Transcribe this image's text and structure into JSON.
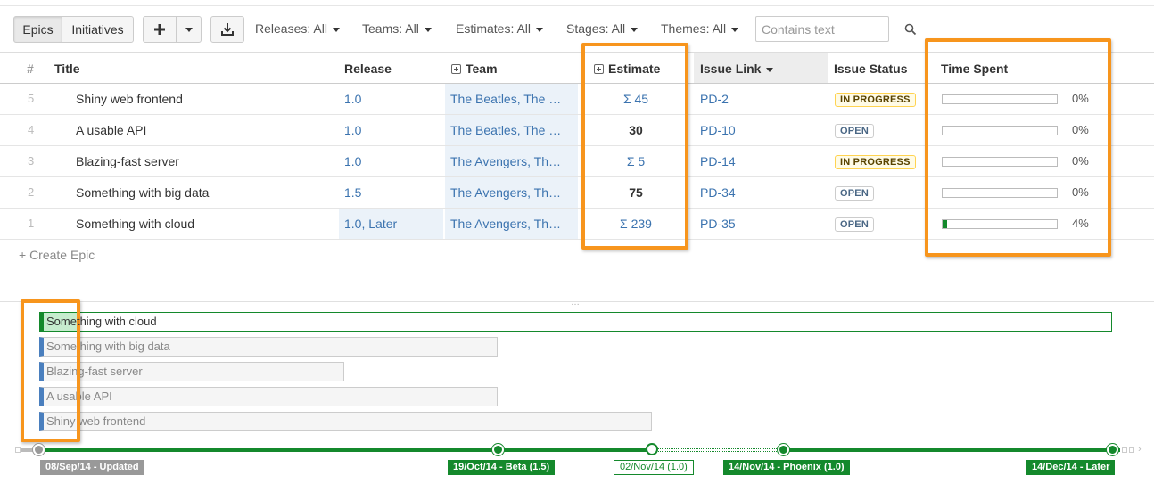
{
  "toolbar": {
    "tabs": [
      {
        "label": "Epics",
        "active": true
      },
      {
        "label": "Initiatives",
        "active": false
      }
    ],
    "add_icon": "plus-icon",
    "dropdown_icon": "chevron-down-icon",
    "download_icon": "download-icon",
    "filters": [
      {
        "label": "Releases: All"
      },
      {
        "label": "Teams: All"
      },
      {
        "label": "Estimates: All"
      },
      {
        "label": "Stages: All"
      },
      {
        "label": "Themes: All"
      }
    ],
    "search": {
      "placeholder": "Contains text",
      "value": "",
      "icon": "search-icon"
    }
  },
  "table": {
    "headers": {
      "num": "#",
      "title": "Title",
      "release": "Release",
      "team": "Team",
      "estimate": "Estimate",
      "issue_link": "Issue Link",
      "issue_status": "Issue Status",
      "time_spent": "Time Spent"
    },
    "rows": [
      {
        "num": "5",
        "title": "Shiny web frontend",
        "release": "1.0",
        "team": "The Beatles, The …",
        "estimate": "Σ 45",
        "issue_link": "PD-2",
        "status": "IN PROGRESS",
        "status_kind": "progress",
        "time_spent_fraction": 0,
        "time_spent": "0%"
      },
      {
        "num": "4",
        "title": "A usable API",
        "release": "1.0",
        "team": "The Beatles, The …",
        "estimate": "30",
        "issue_link": "PD-10",
        "status": "OPEN",
        "status_kind": "open",
        "time_spent_fraction": 0,
        "time_spent": "0%"
      },
      {
        "num": "3",
        "title": "Blazing-fast server",
        "release": "1.0",
        "team": "The Avengers, Th…",
        "estimate": "Σ 5",
        "issue_link": "PD-14",
        "status": "IN PROGRESS",
        "status_kind": "progress",
        "time_spent_fraction": 0,
        "time_spent": "0%"
      },
      {
        "num": "2",
        "title": "Something with big data",
        "release": "1.5",
        "team": "The Avengers, Th…",
        "estimate": "75",
        "issue_link": "PD-34",
        "status": "OPEN",
        "status_kind": "open",
        "time_spent_fraction": 0,
        "time_spent": "0%"
      },
      {
        "num": "1",
        "title": "Something with cloud",
        "release": "1.0, Later",
        "team": "The Avengers, Th…",
        "estimate": "Σ 239",
        "issue_link": "PD-35",
        "status": "OPEN",
        "status_kind": "open",
        "time_spent_fraction": 0.04,
        "time_spent": "4%"
      }
    ],
    "create_label": "+ Create Epic"
  },
  "timeline": {
    "handle": "…",
    "lanes": [
      {
        "label": "Something with cloud"
      },
      {
        "label": "Something with big data"
      },
      {
        "label": "Blazing-fast server"
      },
      {
        "label": "A usable API"
      },
      {
        "label": "Shiny web frontend"
      }
    ],
    "markers": [
      {
        "label": "08/Sep/14 - Updated"
      },
      {
        "label": "19/Oct/14 - Beta (1.5)"
      },
      {
        "label": "02/Nov/14 (1.0)"
      },
      {
        "label": "14/Nov/14 - Phoenix (1.0)"
      },
      {
        "label": "14/Dec/14 - Later"
      }
    ]
  },
  "colors": {
    "highlight_box": "#f7951d",
    "progress_green": "#14892c",
    "link_blue": "#3b73af",
    "lane_blue": "#4a7fbe"
  }
}
